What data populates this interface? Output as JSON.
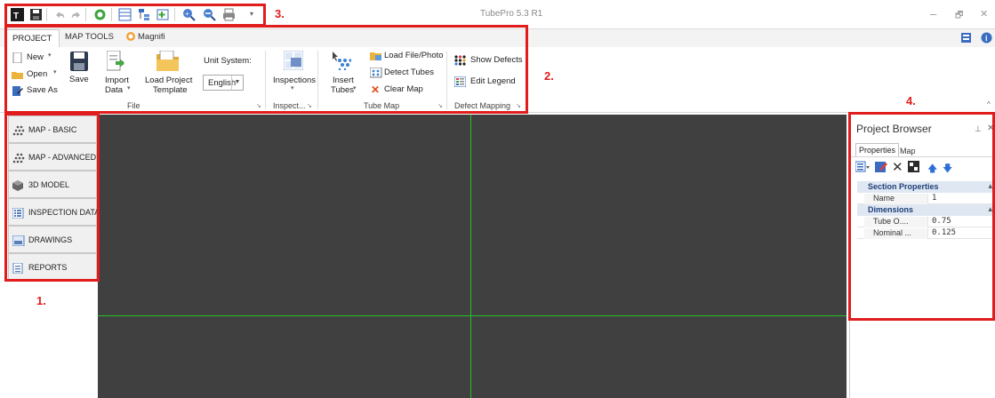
{
  "window": {
    "title": "TubePro 5.3 R1",
    "controls": {
      "minimize": "–",
      "restore": "🗗",
      "close": "✕"
    }
  },
  "ribbon": {
    "tabs": [
      {
        "label": "PROJECT"
      },
      {
        "label": "MAP TOOLS"
      },
      {
        "label": "Magnifi"
      }
    ],
    "file_group": {
      "label": "File",
      "new_label": "New",
      "open_label": "Open",
      "save_as_label": "Save As",
      "save_label": "Save",
      "import_label_1": "Import",
      "import_label_2": "Data",
      "load_template_1": "Load Project",
      "load_template_2": "Template",
      "unit_system_label": "Unit System:",
      "unit_system_value": "English"
    },
    "inspections_group": {
      "label": "Inspect...",
      "inspections_label": "Inspections"
    },
    "tube_map_group": {
      "label": "Tube Map",
      "insert_1": "Insert",
      "insert_2": "Tubes",
      "load_file_label": "Load File/Photo",
      "detect_tubes_label": "Detect Tubes",
      "clear_map_label": "Clear Map"
    },
    "defect_group": {
      "label": "Defect Mapping",
      "show_defects_label": "Show Defects",
      "edit_legend_label": "Edit Legend"
    }
  },
  "left_nav": {
    "items": [
      {
        "label": "MAP - BASIC",
        "icon": "tube-grid-icon"
      },
      {
        "label": "MAP - ADVANCED",
        "icon": "tube-grid-icon"
      },
      {
        "label": "3D MODEL",
        "icon": "cube-icon"
      },
      {
        "label": "INSPECTION DATA",
        "icon": "list-icon"
      },
      {
        "label": "DRAWINGS",
        "icon": "drawing-icon"
      },
      {
        "label": "REPORTS",
        "icon": "report-icon"
      }
    ]
  },
  "project_browser": {
    "title": "Project Browser",
    "tabs": [
      {
        "label": "Properties"
      },
      {
        "label": "Map"
      }
    ],
    "sections": [
      {
        "title": "Section Properties",
        "rows": [
          {
            "key": "Name",
            "value": "1"
          }
        ]
      },
      {
        "title": "Dimensions",
        "rows": [
          {
            "key": "Tube O....",
            "value": "0.75"
          },
          {
            "key": "Nominal ...",
            "value": "0.125"
          }
        ]
      }
    ]
  },
  "annotations": {
    "label_1": "1.",
    "label_2": "2.",
    "label_3": "3.",
    "label_4": "4."
  },
  "colors": {
    "annotation_red": "#e01c1c",
    "crosshair_green": "#25c325",
    "map_background": "#404040"
  }
}
